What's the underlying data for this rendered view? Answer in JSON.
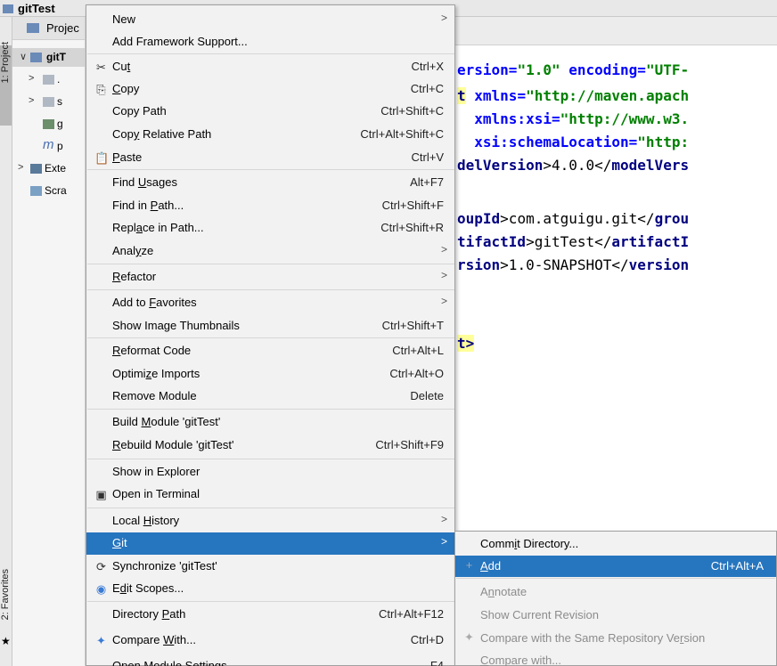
{
  "window": {
    "title": "gitTest"
  },
  "sidebar": {
    "project_tab": "1: Project",
    "favorites_tab": "2: Favorites"
  },
  "project_panel": {
    "tab_label": "Projec",
    "tree": [
      {
        "label": "gitT",
        "expanded": true
      },
      {
        "label": "."
      },
      {
        "label": "s"
      },
      {
        "label": "g"
      },
      {
        "label": "p"
      },
      {
        "label": "Exte"
      },
      {
        "label": "Scra"
      }
    ]
  },
  "editor": {
    "lines": [
      {
        "parts": [
          {
            "t": "ersion=",
            "c": "attr"
          },
          {
            "t": "\"1.0\"",
            "c": "str"
          },
          {
            "t": " encoding=",
            "c": "attr"
          },
          {
            "t": "\"UTF-",
            "c": "str"
          }
        ]
      },
      {
        "parts": [
          {
            "t": "t",
            "c": "tag",
            "hl": true
          },
          {
            "t": " xmlns=",
            "c": "attr"
          },
          {
            "t": "\"http://maven.apach",
            "c": "str"
          }
        ]
      },
      {
        "parts": [
          {
            "t": "  xmlns:xsi=",
            "c": "attr"
          },
          {
            "t": "\"http://www.w3.",
            "c": "str"
          }
        ]
      },
      {
        "parts": [
          {
            "t": "  xsi:schemaLocation=",
            "c": "attr"
          },
          {
            "t": "\"http:",
            "c": "str"
          }
        ]
      },
      {
        "parts": [
          {
            "t": "delVersion",
            "c": "tag"
          },
          {
            "t": ">4.0.0</",
            "c": ""
          },
          {
            "t": "modelVers",
            "c": "tag"
          }
        ]
      },
      {
        "parts": [
          {
            "t": "oupId",
            "c": "tag"
          },
          {
            "t": ">com.atguigu.git</",
            "c": ""
          },
          {
            "t": "grou",
            "c": "tag"
          }
        ]
      },
      {
        "parts": [
          {
            "t": "tifactId",
            "c": "tag"
          },
          {
            "t": ">gitTest</",
            "c": ""
          },
          {
            "t": "artifactI",
            "c": "tag"
          }
        ]
      },
      {
        "parts": [
          {
            "t": "rsion",
            "c": "tag"
          },
          {
            "t": ">1.0-SNAPSHOT</",
            "c": ""
          },
          {
            "t": "version",
            "c": "tag"
          }
        ]
      },
      {
        "parts": [
          {
            "t": "t>",
            "c": "tag",
            "hl": true
          }
        ]
      }
    ]
  },
  "context_menu": {
    "items": [
      {
        "label": "New",
        "shortcut": "",
        "submenu": true
      },
      {
        "label": "Add Framework Support...",
        "shortcut": ""
      },
      {
        "label": "Cut",
        "shortcut": "Ctrl+X",
        "icon": "cut-icon"
      },
      {
        "label": "Copy",
        "shortcut": "Ctrl+C",
        "icon": "copy-icon"
      },
      {
        "label": "Copy Path",
        "shortcut": "Ctrl+Shift+C"
      },
      {
        "label": "Copy Relative Path",
        "shortcut": "Ctrl+Alt+Shift+C"
      },
      {
        "label": "Paste",
        "shortcut": "Ctrl+V",
        "icon": "paste-icon"
      },
      {
        "label": "Find Usages",
        "shortcut": "Alt+F7"
      },
      {
        "label": "Find in Path...",
        "shortcut": "Ctrl+Shift+F"
      },
      {
        "label": "Replace in Path...",
        "shortcut": "Ctrl+Shift+R"
      },
      {
        "label": "Analyze",
        "shortcut": "",
        "submenu": true
      },
      {
        "label": "Refactor",
        "shortcut": "",
        "submenu": true
      },
      {
        "label": "Add to Favorites",
        "shortcut": "",
        "submenu": true
      },
      {
        "label": "Show Image Thumbnails",
        "shortcut": "Ctrl+Shift+T"
      },
      {
        "label": "Reformat Code",
        "shortcut": "Ctrl+Alt+L"
      },
      {
        "label": "Optimize Imports",
        "shortcut": "Ctrl+Alt+O"
      },
      {
        "label": "Remove Module",
        "shortcut": "Delete"
      },
      {
        "label": "Build Module 'gitTest'",
        "shortcut": ""
      },
      {
        "label": "Rebuild Module 'gitTest'",
        "shortcut": "Ctrl+Shift+F9"
      },
      {
        "label": "Show in Explorer",
        "shortcut": ""
      },
      {
        "label": "Open in Terminal",
        "shortcut": "",
        "icon": "terminal-icon"
      },
      {
        "label": "Local History",
        "shortcut": "",
        "submenu": true
      },
      {
        "label": "Git",
        "shortcut": "",
        "submenu": true,
        "active": true
      },
      {
        "label": "Synchronize 'gitTest'",
        "shortcut": "",
        "icon": "sync-icon"
      },
      {
        "label": "Edit Scopes...",
        "shortcut": "",
        "icon": "scope-icon"
      },
      {
        "label": "Directory Path",
        "shortcut": "Ctrl+Alt+F12"
      },
      {
        "label": "Compare With...",
        "shortcut": "Ctrl+D",
        "icon": "compare-icon"
      },
      {
        "label": "Open Module Settings",
        "shortcut": "F4"
      }
    ]
  },
  "git_submenu": {
    "items": [
      {
        "label": "Commit Directory...",
        "shortcut": ""
      },
      {
        "label": "Add",
        "shortcut": "Ctrl+Alt+A",
        "active": true
      },
      {
        "label": "Annotate",
        "shortcut": "",
        "disabled": true
      },
      {
        "label": "Show Current Revision",
        "shortcut": "",
        "disabled": true
      },
      {
        "label": "Compare with the Same Repository Version",
        "shortcut": "",
        "disabled": true
      },
      {
        "label": "Compare with...",
        "shortcut": "",
        "disabled": true
      }
    ]
  },
  "colors": {
    "selection": "#2675bf",
    "menu_bg": "#f2f2f2"
  }
}
